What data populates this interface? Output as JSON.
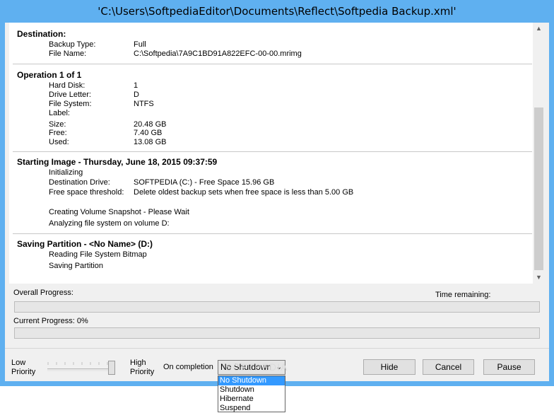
{
  "window": {
    "title": "'C:\\Users\\SoftpediaEditor\\Documents\\Reflect\\Softpedia Backup.xml'"
  },
  "log": {
    "destination": {
      "title": "Destination:",
      "rows": [
        {
          "label": "Backup Type:",
          "value": "Full"
        },
        {
          "label": "File Name:",
          "value": "C:\\Softpedia\\7A9C1BD91A822EFC-00-00.mrimg"
        }
      ]
    },
    "operation": {
      "title": "Operation 1 of 1",
      "rows": [
        {
          "label": "Hard Disk:",
          "value": "1"
        },
        {
          "label": "Drive Letter:",
          "value": "D"
        },
        {
          "label": "File System:",
          "value": "NTFS"
        },
        {
          "label": "Label:",
          "value": ""
        },
        {
          "label": "Size:",
          "value": "20.48 GB"
        },
        {
          "label": "Free:",
          "value": "7.40 GB"
        },
        {
          "label": "Used:",
          "value": "13.08 GB"
        }
      ]
    },
    "starting": {
      "title": "Starting Image - Thursday, June 18, 2015 09:37:59",
      "initializing": "Initializing",
      "rows": [
        {
          "label": "Destination Drive:",
          "value": "SOFTPEDIA (C:) - Free Space 15.96 GB"
        },
        {
          "label": "Free space threshold:",
          "value": "Delete oldest backup sets when free space is less than 5.00 GB"
        }
      ],
      "snapshot": "Creating Volume Snapshot - Please Wait",
      "analyzing": "Analyzing file system on volume D:"
    },
    "saving": {
      "title": "Saving Partition - <No Name> (D:)",
      "lines": [
        "Reading File System Bitmap",
        "Saving Partition"
      ]
    }
  },
  "progress": {
    "overall_label": "Overall Progress:",
    "time_remaining_label": "Time remaining:",
    "current_label": "Current Progress:",
    "current_value": "0%",
    "overall_fraction": 0,
    "current_fraction": 0
  },
  "footer": {
    "low_priority": [
      "Low",
      "Priority"
    ],
    "high_priority": [
      "High",
      "Priority"
    ],
    "on_completion_label": "On completion",
    "on_completion_selected": "No Shutdown",
    "on_completion_options": [
      "No Shutdown",
      "Shutdown",
      "Hibernate",
      "Suspend"
    ],
    "hide_label": "Hide",
    "cancel_label": "Cancel",
    "pause_label": "Pause"
  },
  "watermark": "SOFTPEDIA"
}
